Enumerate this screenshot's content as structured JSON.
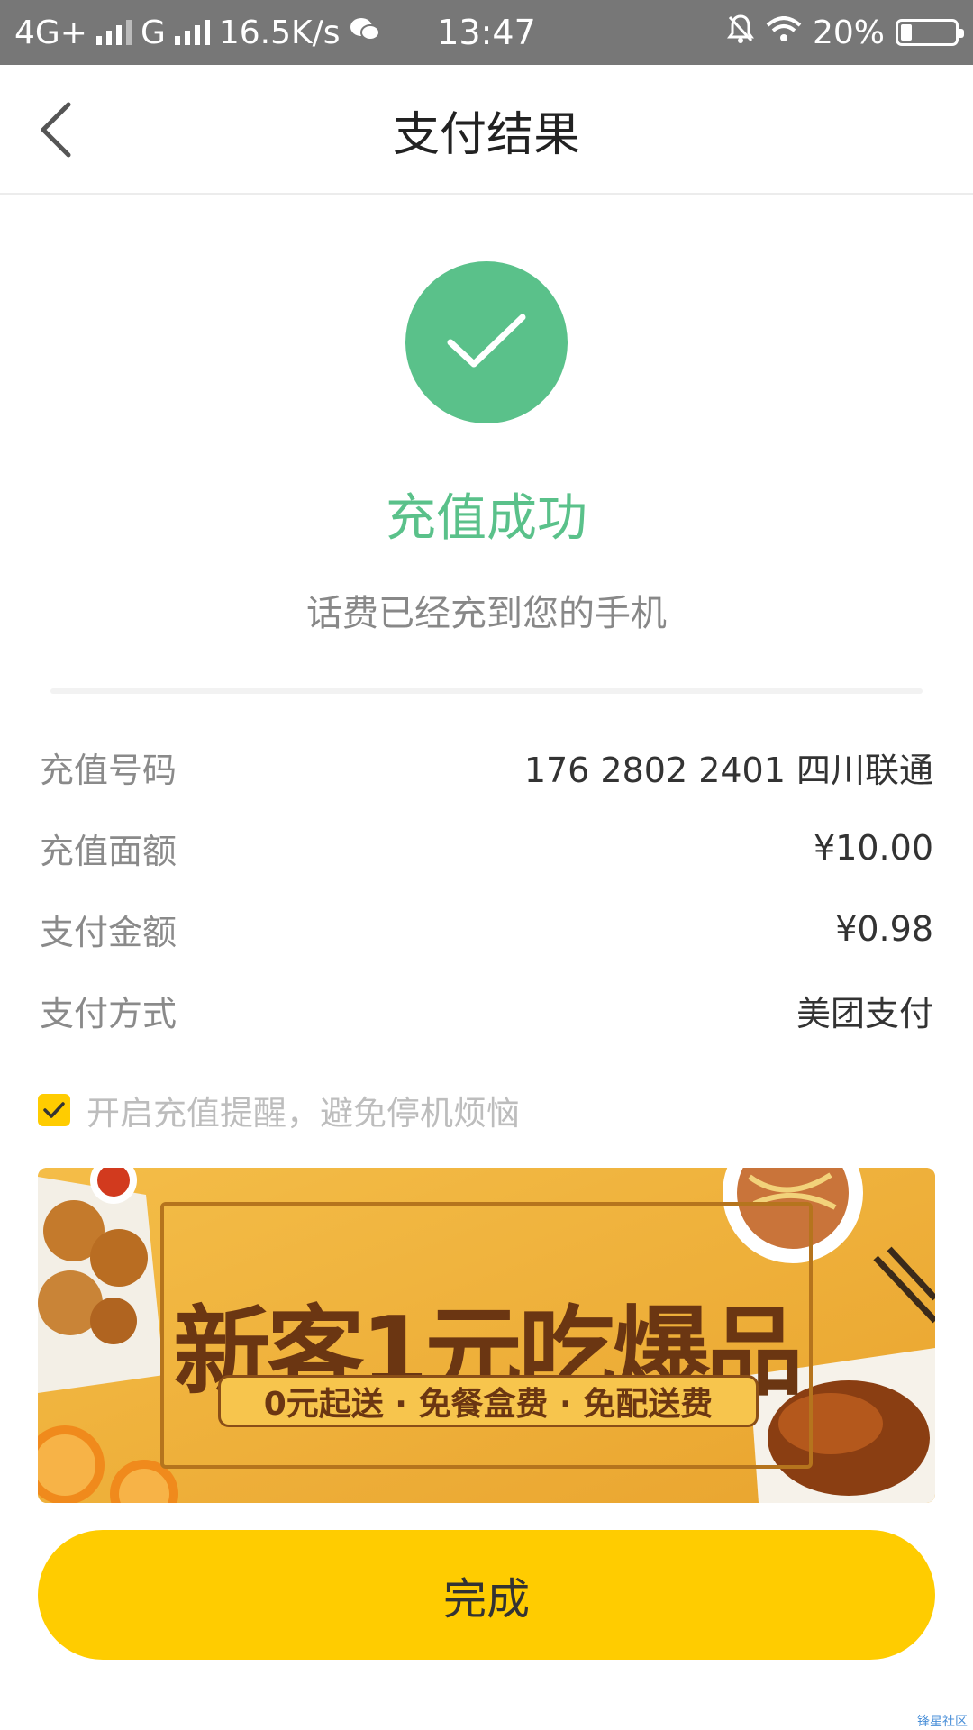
{
  "status_bar": {
    "network_1": "4G+",
    "network_2": "G",
    "speed": "16.5K/s",
    "time": "13:47",
    "battery": "20%",
    "battery_level": 0.2,
    "icons": [
      "signal-icon",
      "wechat-icon",
      "mute-bell-icon",
      "wifi-icon",
      "battery-icon"
    ]
  },
  "nav": {
    "title": "支付结果",
    "back_icon": "chevron-left-icon"
  },
  "result": {
    "title": "充值成功",
    "subtitle": "话费已经充到您的手机",
    "icon": "checkmark-icon",
    "accent": "#5ac18a"
  },
  "details": [
    {
      "label": "充值号码",
      "value": "176 2802 2401 四川联通"
    },
    {
      "label": "充值面额",
      "value": "¥10.00"
    },
    {
      "label": "支付金额",
      "value": "¥0.98"
    },
    {
      "label": "支付方式",
      "value": "美团支付"
    }
  ],
  "reminder": {
    "checked": true,
    "text": "开启充值提醒，避免停机烦恼"
  },
  "banner": {
    "title": "新客1元吃爆品",
    "tagline": "0元起送 · 免餐盒费 · 免配送费"
  },
  "done_button": {
    "label": "完成",
    "color": "#ffcc00"
  },
  "watermark": "锋星社区"
}
